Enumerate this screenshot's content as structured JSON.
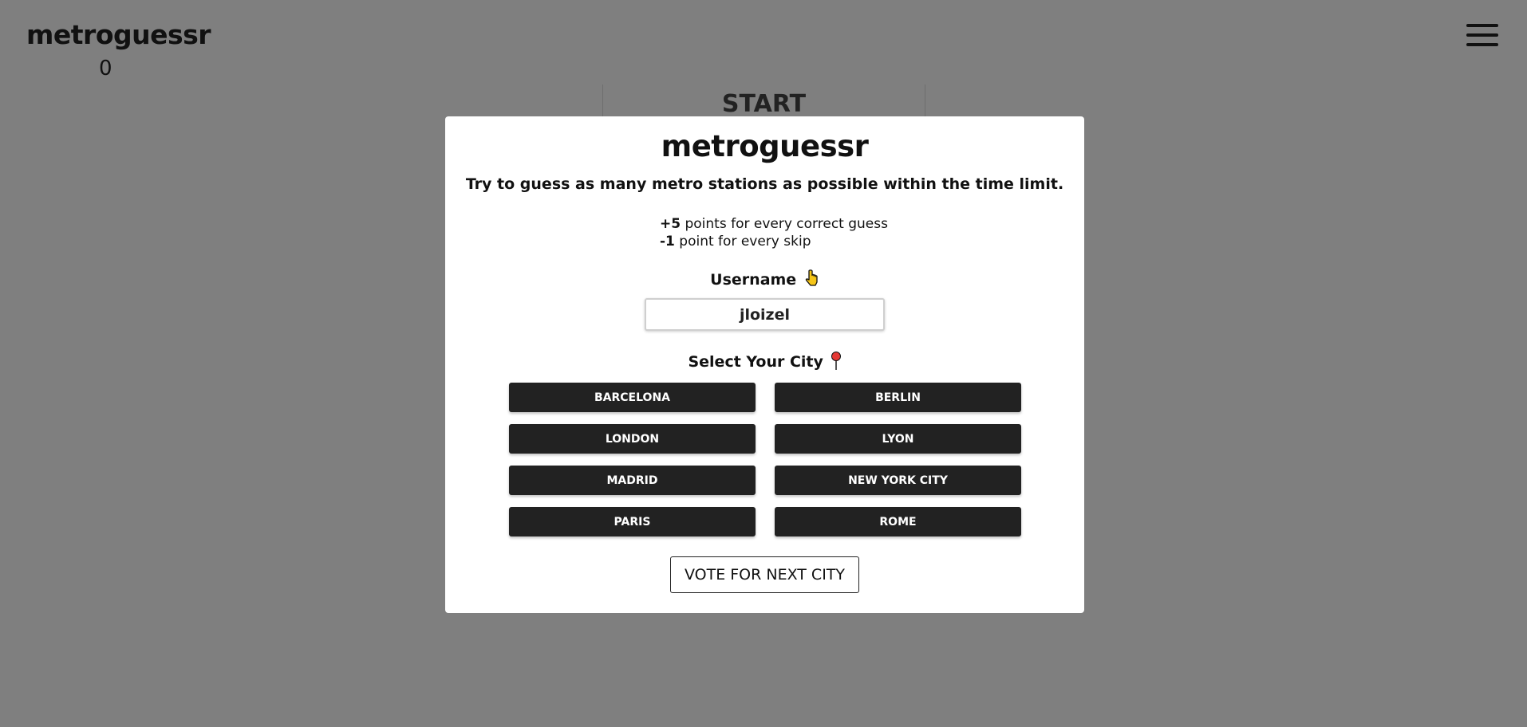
{
  "header": {
    "logo": "metroguessr",
    "score": "0",
    "start_label": "START"
  },
  "modal": {
    "title": "metroguessr",
    "subtitle": "Try to guess as many metro stations as possible within the time limit.",
    "rules": [
      {
        "bold": "+5",
        "text": " points for every correct guess"
      },
      {
        "bold": "-1",
        "text": " point for every skip"
      }
    ],
    "username_label": "Username",
    "username_value": "jloizel",
    "city_label": "Select Your City",
    "cities": [
      "Barcelona",
      "Berlin",
      "London",
      "Lyon",
      "Madrid",
      "New York City",
      "Paris",
      "Rome"
    ],
    "vote_label": "VOTE FOR NEXT CITY"
  },
  "icons": {
    "pointing_hand": "pointing-down-hand-icon",
    "pin": "round-pushpin-icon",
    "menu": "hamburger-menu-icon"
  },
  "colors": {
    "button_dark": "#222222",
    "overlay": "rgba(0,0,0,0.5)",
    "pointer_yellow": "#f5c518",
    "pin_red": "#e53935"
  }
}
